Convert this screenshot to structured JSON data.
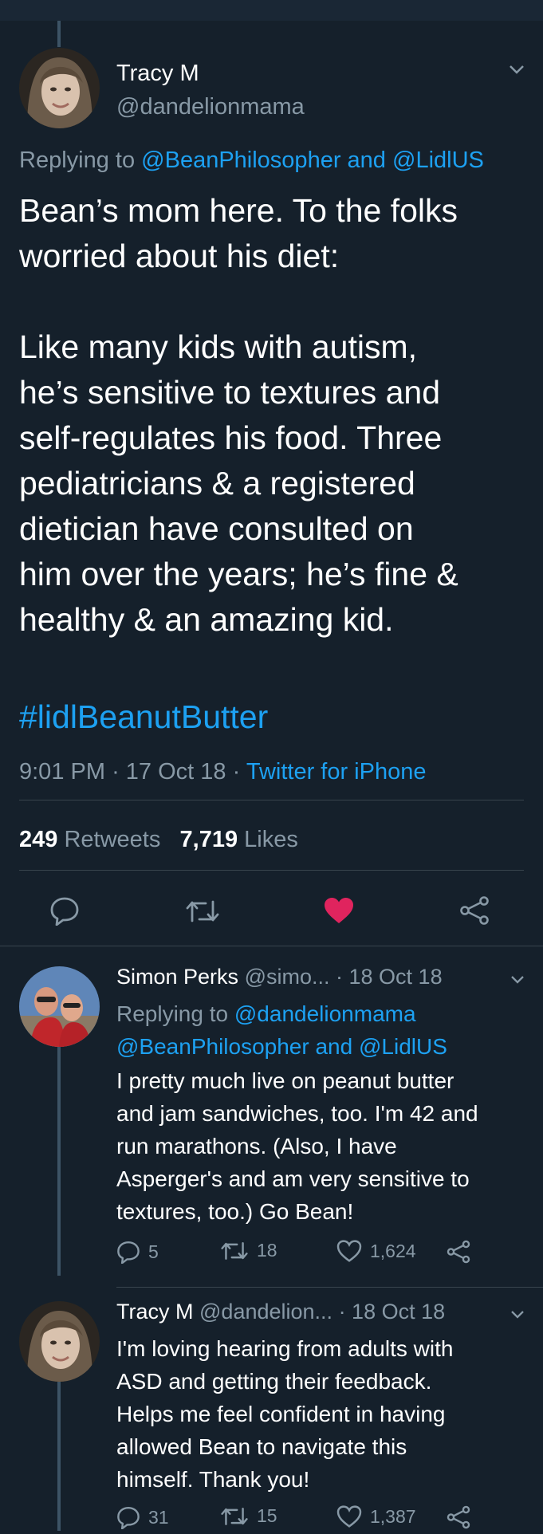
{
  "main_tweet": {
    "author_name": "Tracy M",
    "author_handle": "@dandelionmama",
    "replying_prefix": "Replying to",
    "replying_to_1": "@BeanPhilosopher",
    "replying_and": "and",
    "replying_to_2": "@LidlUS",
    "text": "Bean’s mom here. To the folks\nworried about his diet:\n\nLike many kids with autism,\nhe’s sensitive to textures and\nself-regulates his food. Three\npediatricians & a registered\ndietician have consulted on\nhim over the years; he’s fine &\nhealthy & an amazing kid.",
    "hashtag": "#lidlBeanutButter",
    "time": "9:01 PM",
    "sep": "·",
    "date": "17 Oct 18",
    "source": "Twitter for iPhone",
    "retweets_count": "249",
    "retweets_label": "Retweets",
    "likes_count": "7,719",
    "likes_label": "Likes",
    "liked": true,
    "like_color": "#e0245e"
  },
  "replies": [
    {
      "author_name": "Simon Perks",
      "author_handle": "@simo...",
      "date": "· 18 Oct 18",
      "replying_prefix": "Replying to",
      "replying_line1": "@dandelionmama",
      "replying_line2a": "@BeanPhilosopher",
      "replying_and": "and",
      "replying_line2b": "@LidlUS",
      "text": "I pretty much live on peanut butter\nand jam sandwiches, too. I'm 42 and\nrun marathons. (Also, I have\nAsperger's and am very sensitive to\ntextures, too.) Go Bean!",
      "reply_count": "5",
      "retweet_count": "18",
      "like_count": "1,624"
    },
    {
      "author_name": "Tracy M",
      "author_handle": "@dandelion...",
      "date": "· 18 Oct 18",
      "text": "I'm loving hearing from adults with\nASD and getting their feedback.\nHelps me feel confident in having\nallowed Bean to navigate this\nhimself. Thank you!",
      "reply_count": "31",
      "retweet_count": "15",
      "like_count": "1,387"
    }
  ],
  "colors": {
    "background": "#15202b",
    "accent": "#1da1f2",
    "secondary_text": "#8899a6",
    "divider": "#38444d",
    "like": "#e0245e"
  }
}
